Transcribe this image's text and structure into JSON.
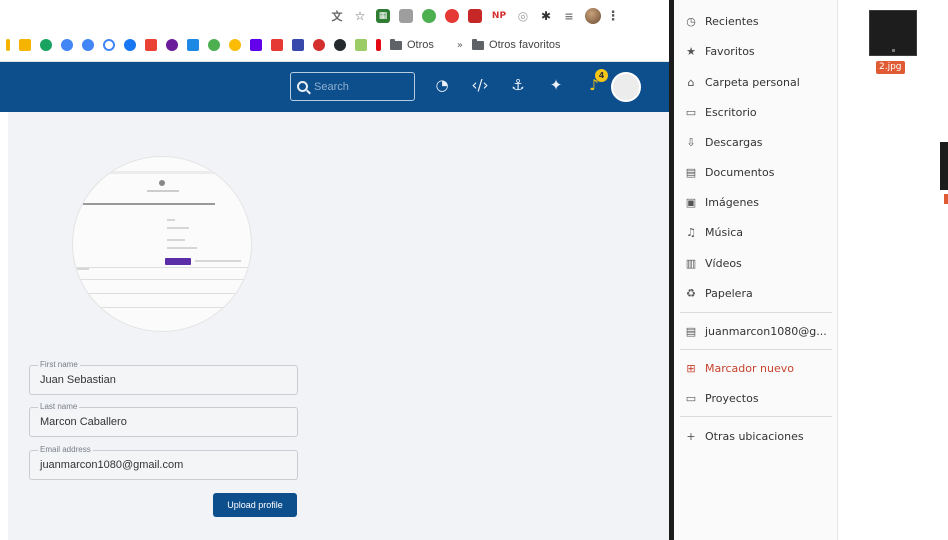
{
  "browser": {
    "extensions": [
      {
        "icon": "translate-icon",
        "color": "#666666"
      },
      {
        "icon": "star-icon",
        "color": "#555555"
      },
      {
        "icon": "grid-ext-icon",
        "color": "#2e7d32"
      },
      {
        "icon": "chat-ext-icon",
        "color": "#9e9e9e"
      },
      {
        "icon": "leaf-ext-icon",
        "color": "#4caf50"
      },
      {
        "icon": "shield-ext-icon",
        "color": "#e53935"
      },
      {
        "icon": "image-ext-icon",
        "color": "#c62828"
      },
      {
        "icon": "np-ext-icon",
        "color": "#d32f2f",
        "text": "NP"
      },
      {
        "icon": "eye-ext-icon",
        "color": "#9e9e9e"
      },
      {
        "icon": "puzzle-icon",
        "color": "#333333"
      },
      {
        "icon": "list-ext-icon",
        "color": "#777777"
      }
    ],
    "bookmarks_folders": [
      {
        "label": "Otros"
      },
      {
        "label": "Otros favoritos"
      }
    ],
    "bookmark_colors": [
      "#f4b400",
      "#1aa260",
      "#4285f4",
      "#0f9d58",
      "#4285f4",
      "#1877f2",
      "#ea4335",
      "#6a1b9a",
      "#1e88e5",
      "#4caf50",
      "#fbbc05",
      "#6200ea",
      "#e53935",
      "#3949ab",
      "#d32f2f",
      "#24292e",
      "#9ccc65",
      "#e50914"
    ]
  },
  "header": {
    "search_placeholder": "Search",
    "icons": [
      "dashboard-icon",
      "code-icon",
      "anchor-icon",
      "run-icon",
      "bell-icon"
    ],
    "notification_count": "4",
    "brand_color": "#0d4e8c"
  },
  "form": {
    "first_name_label": "First name",
    "first_name_value": "Juan Sebastian",
    "last_name_label": "Last name",
    "last_name_value": "Marcon Caballero",
    "email_label": "Email address",
    "email_value": "juanmarcon1080@gmail.com",
    "upload_label": "Upload profile"
  },
  "file_manager": {
    "items": [
      {
        "icon": "clock-icon",
        "label": "Recientes"
      },
      {
        "icon": "star-icon",
        "label": "Favoritos"
      },
      {
        "icon": "home-icon",
        "label": "Carpeta personal"
      },
      {
        "icon": "desktop-icon",
        "label": "Escritorio"
      },
      {
        "icon": "download-icon",
        "label": "Descargas"
      },
      {
        "icon": "document-icon",
        "label": "Documentos"
      },
      {
        "icon": "image-icon",
        "label": "Imágenes"
      },
      {
        "icon": "music-icon",
        "label": "Música"
      },
      {
        "icon": "video-icon",
        "label": "Vídeos"
      },
      {
        "icon": "trash-icon",
        "label": "Papelera"
      },
      {
        "icon": "drive-icon",
        "label": "juanmarcon1080@g..."
      },
      {
        "icon": "bookmark-new-icon",
        "label": "Marcador nuevo"
      },
      {
        "icon": "folder-icon",
        "label": "Proyectos"
      },
      {
        "icon": "plus-icon",
        "label": "Otras ubicaciones"
      }
    ]
  },
  "desktop": {
    "file_label": "2.jpg"
  }
}
